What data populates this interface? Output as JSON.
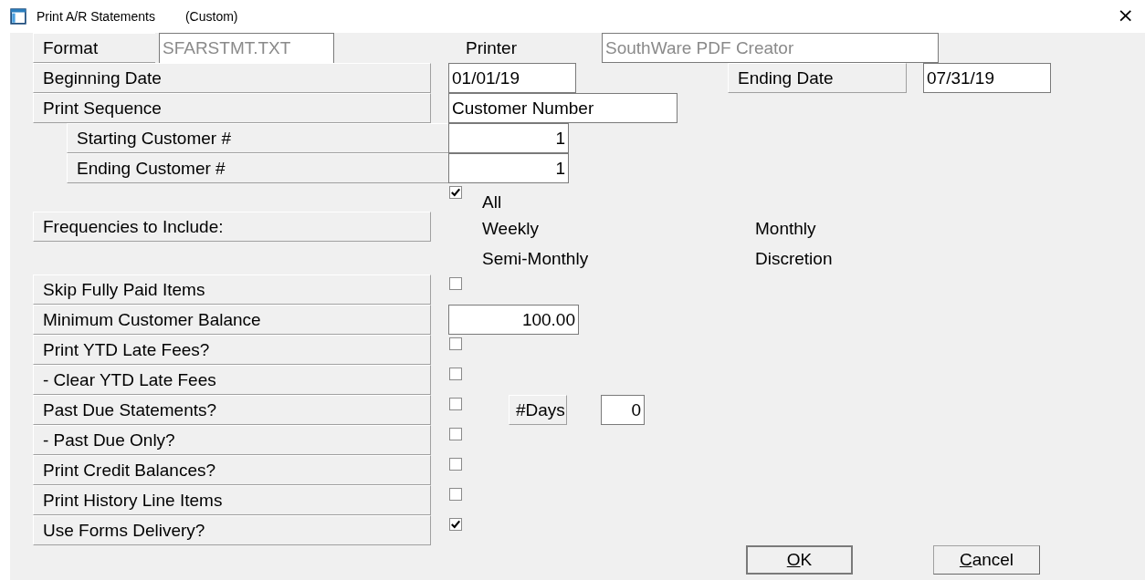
{
  "window": {
    "title": "Print A/R Statements",
    "subtitle": "(Custom)",
    "close": "×"
  },
  "format": {
    "label": "Format",
    "value": "SFARSTMT.TXT",
    "disabled": true
  },
  "printer": {
    "label": "Printer",
    "value": "SouthWare PDF Creator",
    "disabled": true
  },
  "beginning_date": {
    "label": "Beginning Date",
    "value": "01/01/19"
  },
  "ending_date": {
    "label": "Ending Date",
    "value": "07/31/19"
  },
  "print_sequence": {
    "label": "Print Sequence",
    "value": "Customer Number"
  },
  "customer_range": [
    {
      "label": "Starting Customer #",
      "value": "1"
    },
    {
      "label": "Ending Customer #",
      "value": "1"
    }
  ],
  "frequencies": {
    "label": "Frequencies to Include:",
    "all": {
      "label": "All",
      "checked": true
    },
    "options": [
      {
        "label": "Weekly"
      },
      {
        "label": "Monthly"
      },
      {
        "label": "Semi-Monthly"
      },
      {
        "label": "Discretion"
      }
    ]
  },
  "options": [
    {
      "kind": "check",
      "label": "Skip Fully Paid Items",
      "checked": false
    },
    {
      "kind": "field",
      "label": "Minimum Customer Balance",
      "value": "100.00"
    },
    {
      "kind": "check",
      "label": "Print YTD Late Fees?",
      "checked": false
    },
    {
      "kind": "check",
      "label": "- Clear YTD Late Fees",
      "checked": false
    },
    {
      "kind": "check",
      "label": "Past Due Statements?",
      "checked": false,
      "extra": {
        "label": "#Days",
        "value": "0"
      }
    },
    {
      "kind": "check",
      "label": "- Past Due Only?",
      "checked": false
    },
    {
      "kind": "check",
      "label": "Print Credit Balances?",
      "checked": false
    },
    {
      "kind": "check",
      "label": "Print History Line Items",
      "checked": false
    },
    {
      "kind": "check",
      "label": "Use Forms Delivery?",
      "checked": true
    }
  ],
  "buttons": [
    {
      "access_key": "O",
      "label_rest": "K",
      "default": true
    },
    {
      "access_key": "C",
      "label_rest": "ancel",
      "default": false
    }
  ]
}
